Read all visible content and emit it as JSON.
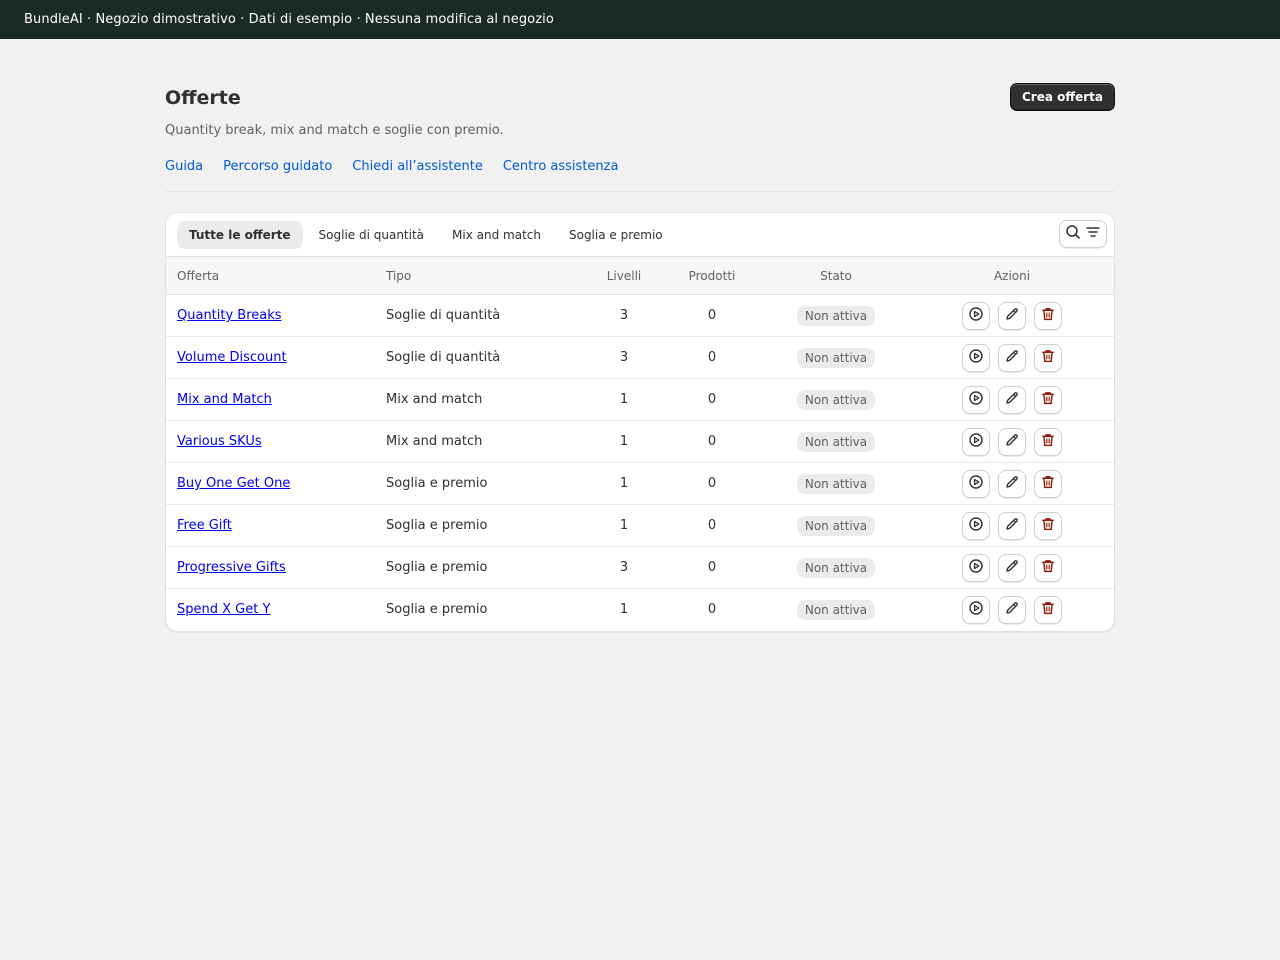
{
  "banner": {
    "text": "BundleAI · Negozio dimostrativo · Dati di esempio · Nessuna modifica al negozio",
    "background": "#1a2a24"
  },
  "header": {
    "title": "Offerte",
    "create_label": "Crea offerta",
    "subtitle": "Quantity break, mix and match e soglie con premio."
  },
  "links": [
    "Guida",
    "Percorso guidato",
    "Chiedi all’assistente",
    "Centro assistenza"
  ],
  "tabs": [
    {
      "label": "Tutte le offerte",
      "active": true
    },
    {
      "label": "Soglie di quantità",
      "active": false
    },
    {
      "label": "Mix and match",
      "active": false
    },
    {
      "label": "Soglia e premio",
      "active": false
    }
  ],
  "filter_icons": [
    "search-icon",
    "filter-icon"
  ],
  "table": {
    "columns": [
      "Offerta",
      "Tipo",
      "Livelli",
      "Prodotti",
      "Stato",
      "Azioni"
    ],
    "rows": [
      {
        "name": "Quantity Breaks",
        "type": "Soglie di quantità",
        "levels": "3",
        "products": "0",
        "status": "Non attiva"
      },
      {
        "name": "Volume Discount",
        "type": "Soglie di quantità",
        "levels": "3",
        "products": "0",
        "status": "Non attiva"
      },
      {
        "name": "Mix and Match",
        "type": "Mix and match",
        "levels": "1",
        "products": "0",
        "status": "Non attiva"
      },
      {
        "name": "Various SKUs",
        "type": "Mix and match",
        "levels": "1",
        "products": "0",
        "status": "Non attiva"
      },
      {
        "name": "Buy One Get One",
        "type": "Soglia e premio",
        "levels": "1",
        "products": "0",
        "status": "Non attiva"
      },
      {
        "name": "Free Gift",
        "type": "Soglia e premio",
        "levels": "1",
        "products": "0",
        "status": "Non attiva"
      },
      {
        "name": "Progressive Gifts",
        "type": "Soglia e premio",
        "levels": "3",
        "products": "0",
        "status": "Non attiva"
      },
      {
        "name": "Spend X Get Y",
        "type": "Soglia e premio",
        "levels": "1",
        "products": "0",
        "status": "Non attiva"
      }
    ],
    "row_actions": [
      "play-circle-icon",
      "pencil-icon",
      "trash-icon"
    ]
  },
  "colors": {
    "link": "#005bd3",
    "offer_link": "#0000ee",
    "delete": "#8e1f0b",
    "primary_button": "#303030"
  }
}
